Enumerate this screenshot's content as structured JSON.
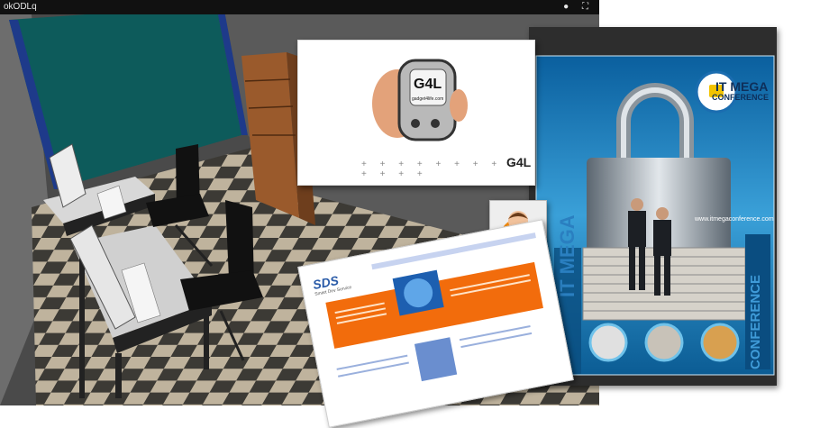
{
  "window": {
    "title": "okODLq",
    "icons": [
      "info-icon",
      "expand-icon"
    ]
  },
  "gadget_card": {
    "logo_text": "G4L",
    "site_text": "gadget4life.com",
    "corner_logo": "G4L",
    "plus_marks": "+ + + + + + + + + + + + +"
  },
  "itmega_card": {
    "logo_line1": "IT MEGA",
    "logo_line2": "CONFERENCE",
    "url": "www.itmegaconference.com",
    "side_left": "IT MEGA",
    "side_right": "CONFERENCE"
  },
  "sds_card": {
    "logo": "SDS",
    "tagline": "Smart Dev Service"
  },
  "colors": {
    "itmega_blue": "#1d6fa8",
    "sds_orange": "#f26c0c",
    "avatar_orange": "#f08a10",
    "teal_wall": "#0d5b5b"
  }
}
